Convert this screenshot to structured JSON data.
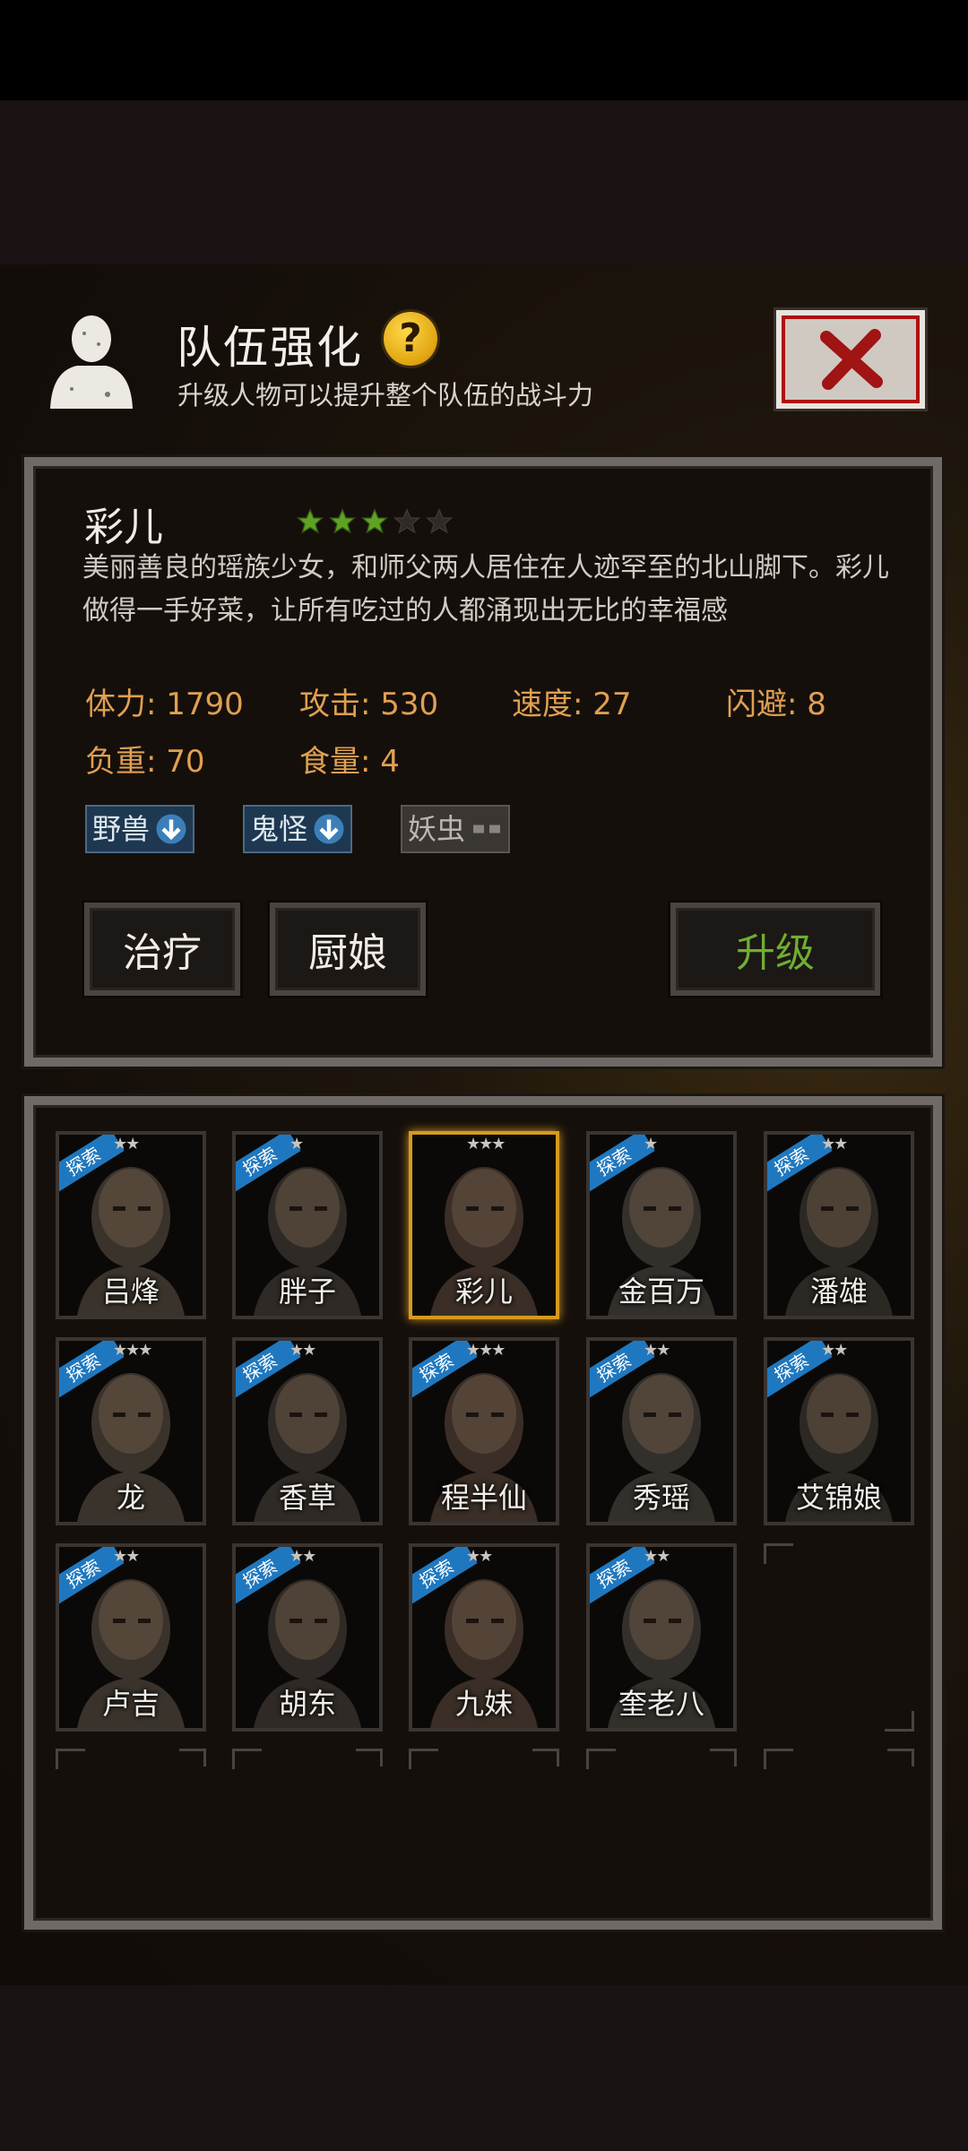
{
  "header": {
    "title": "队伍强化",
    "help": "?",
    "subtitle": "升级人物可以提升整个队伍的战斗力"
  },
  "character": {
    "name": "彩儿",
    "stars_filled": 3,
    "stars_total": 5,
    "description": "美丽善良的瑶族少女，和师父两人居住在人迹罕至的北山脚下。彩儿做得一手好菜，让所有吃过的人都涌现出无比的幸福感",
    "stats": {
      "hp": "体力: 1790",
      "attack": "攻击: 530",
      "speed": "速度: 27",
      "dodge": "闪避: 8",
      "load": "负重: 70",
      "food": "食量: 4"
    },
    "tags": [
      {
        "label": "野兽",
        "state": "down"
      },
      {
        "label": "鬼怪",
        "state": "down"
      },
      {
        "label": "妖虫",
        "state": "neutral"
      }
    ],
    "buttons": {
      "heal": "治疗",
      "cook": "厨娘",
      "upgrade": "升级"
    }
  },
  "roster": [
    {
      "name": "吕烽",
      "stars": "★★",
      "ribbon": "探索"
    },
    {
      "name": "胖子",
      "stars": "★",
      "ribbon": "探索"
    },
    {
      "name": "彩儿",
      "stars": "★★★",
      "ribbon": "",
      "selected": true
    },
    {
      "name": "金百万",
      "stars": "★",
      "ribbon": "探索"
    },
    {
      "name": "潘雄",
      "stars": "★★",
      "ribbon": "探索"
    },
    {
      "name": "龙",
      "stars": "★★★",
      "ribbon": "探索"
    },
    {
      "name": "香草",
      "stars": "★★",
      "ribbon": "探索"
    },
    {
      "name": "程半仙",
      "stars": "★★★",
      "ribbon": "探索"
    },
    {
      "name": "秀瑶",
      "stars": "★★",
      "ribbon": "探索"
    },
    {
      "name": "艾锦娘",
      "stars": "★★",
      "ribbon": "探索"
    },
    {
      "name": "卢吉",
      "stars": "★★",
      "ribbon": "探索"
    },
    {
      "name": "胡东",
      "stars": "★★",
      "ribbon": "探索"
    },
    {
      "name": "九妹",
      "stars": "★★",
      "ribbon": "探索"
    },
    {
      "name": "奎老八",
      "stars": "★★",
      "ribbon": "探索"
    }
  ],
  "colors": {
    "accent_gold": "#d59a1e",
    "stat_orange": "#e0a050",
    "upgrade_green": "#6fae32",
    "ribbon_blue": "#1f78bf"
  }
}
